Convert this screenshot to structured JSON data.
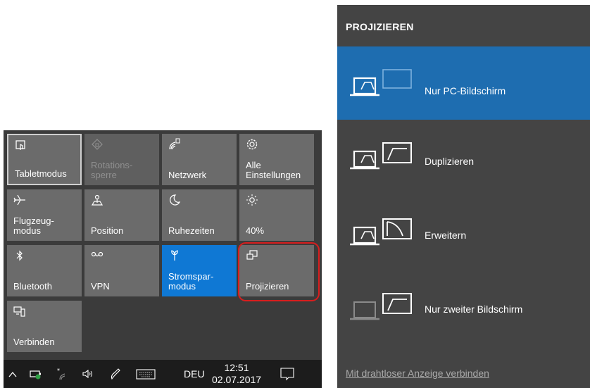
{
  "action_center": {
    "tiles": [
      {
        "label": "Tabletmodus",
        "icon": "tablet-mode-icon",
        "state": "bordered"
      },
      {
        "label": "Rotations-\nsperre",
        "icon": "rotation-lock-icon",
        "state": "disabled"
      },
      {
        "label": "Netzwerk",
        "icon": "network-icon",
        "state": "normal"
      },
      {
        "label": "Alle\nEinstellungen",
        "icon": "settings-gear-icon",
        "state": "normal"
      },
      {
        "label": "Flugzeug-\nmodus",
        "icon": "airplane-icon",
        "state": "normal"
      },
      {
        "label": "Position",
        "icon": "location-icon",
        "state": "normal"
      },
      {
        "label": "Ruhezeiten",
        "icon": "moon-icon",
        "state": "normal"
      },
      {
        "label": "40%",
        "icon": "brightness-icon",
        "state": "normal"
      },
      {
        "label": "Bluetooth",
        "icon": "bluetooth-icon",
        "state": "normal"
      },
      {
        "label": "VPN",
        "icon": "vpn-icon",
        "state": "normal"
      },
      {
        "label": "Stromspar-\nmodus",
        "icon": "battery-saver-icon",
        "state": "active"
      },
      {
        "label": "Projizieren",
        "icon": "project-icon",
        "state": "normal"
      },
      {
        "label": "Verbinden",
        "icon": "connect-icon",
        "state": "normal"
      }
    ]
  },
  "taskbar": {
    "language": "DEU",
    "time": "12:51",
    "date": "02.07.2017"
  },
  "project_panel": {
    "title": "PROJIZIEREN",
    "options": [
      {
        "label": "Nur PC-Bildschirm",
        "selected": true
      },
      {
        "label": "Duplizieren",
        "selected": false
      },
      {
        "label": "Erweitern",
        "selected": false
      },
      {
        "label": "Nur zweiter Bildschirm",
        "selected": false
      }
    ],
    "wireless_link": "Mit drahtloser Anzeige verbinden"
  },
  "colors": {
    "accent": "#0f78d4",
    "selected_option": "#1e6db0",
    "highlight_ring": "#d81e1e"
  }
}
